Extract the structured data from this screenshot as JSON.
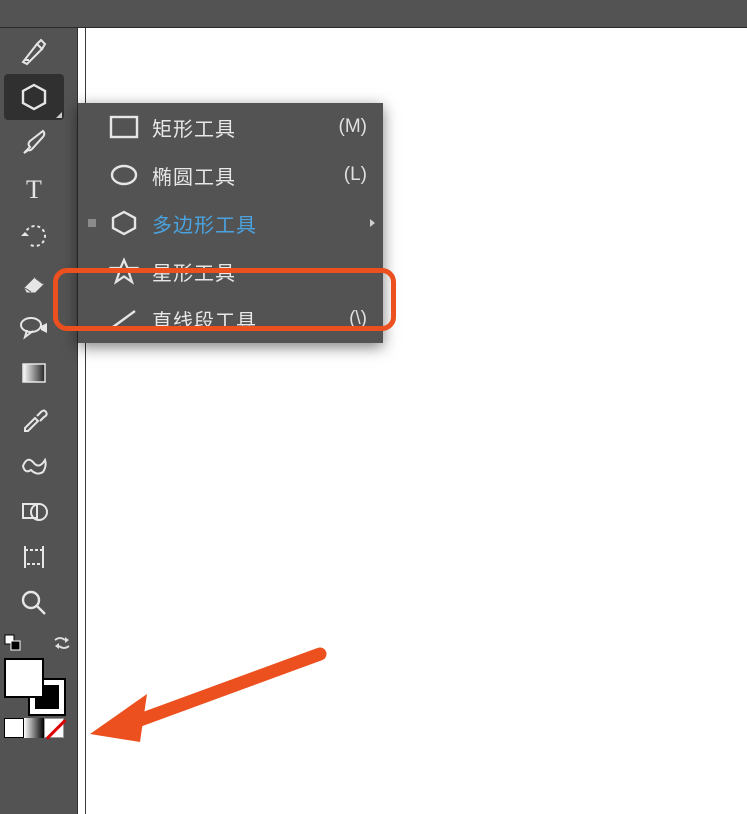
{
  "toolbar": {
    "items": [
      {
        "name": "pen-tool"
      },
      {
        "name": "polygon-tool",
        "selected": true
      },
      {
        "name": "paintbrush-tool"
      },
      {
        "name": "type-tool"
      },
      {
        "name": "rotate-tool"
      },
      {
        "name": "eraser-tool"
      },
      {
        "name": "symbol-sprayer-tool"
      },
      {
        "name": "gradient-tool"
      },
      {
        "name": "eyedropper-tool"
      },
      {
        "name": "blend-tool"
      },
      {
        "name": "shape-builder-tool"
      },
      {
        "name": "artboard-tool"
      },
      {
        "name": "zoom-tool"
      }
    ]
  },
  "flyout": {
    "items": [
      {
        "icon": "rectangle",
        "label": "矩形工具",
        "shortcut": "(M)",
        "active": false
      },
      {
        "icon": "ellipse",
        "label": "椭圆工具",
        "shortcut": "(L)",
        "active": false
      },
      {
        "icon": "polygon",
        "label": "多边形工具",
        "shortcut": "",
        "active": true
      },
      {
        "icon": "star",
        "label": "星形工具",
        "shortcut": "",
        "active": false
      },
      {
        "icon": "line",
        "label": "直线段工具",
        "shortcut": "(\\)",
        "active": false
      }
    ]
  },
  "colors": {
    "fill": "#ffffff",
    "stroke": "#000000"
  },
  "annotation": {
    "highlight_color": "#ec501f",
    "arrow_color": "#ec501f"
  }
}
